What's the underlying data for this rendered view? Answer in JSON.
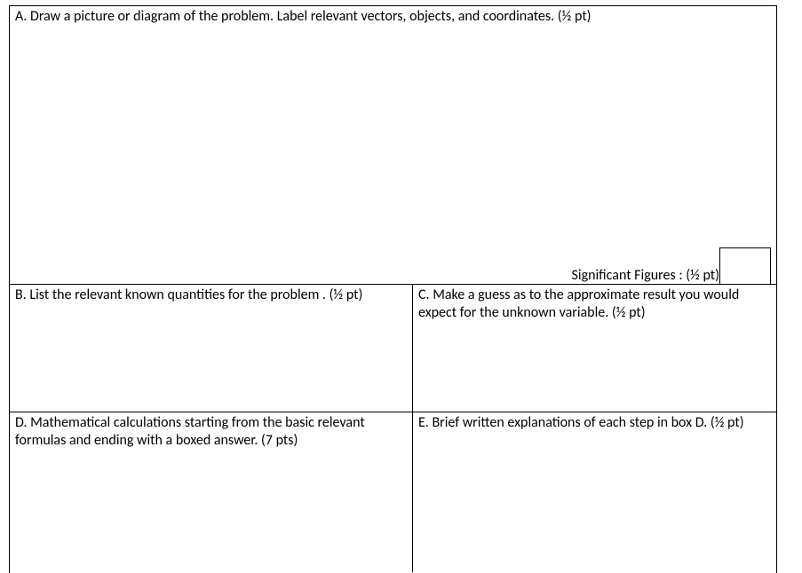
{
  "sectionA": {
    "prompt": "A. Draw a picture or diagram of the problem. Label relevant vectors, objects, and coordinates. (½  pt)",
    "sigfig_label": "Significant Figures : (½  pt)"
  },
  "sectionB": {
    "prompt": "B.  List the relevant known quantities for the problem . (½  pt)"
  },
  "sectionC": {
    "prompt": "C. Make a guess as to the approximate result you would expect for the unknown variable.  (½  pt)"
  },
  "sectionD": {
    "prompt": "D.  Mathematical calculations starting from the basic relevant formulas and ending with a boxed answer. (7 pts)"
  },
  "sectionE": {
    "prompt": "E. Brief written explanations of each step in box D. (½ pt)"
  }
}
